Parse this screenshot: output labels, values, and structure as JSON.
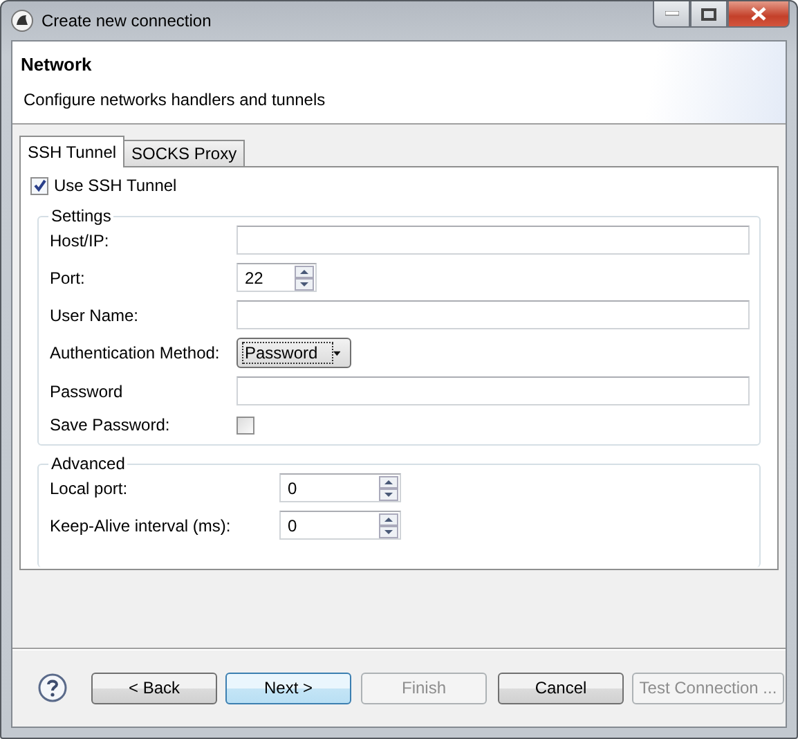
{
  "window": {
    "title": "Create new connection"
  },
  "header": {
    "title": "Network",
    "description": "Configure networks handlers and tunnels"
  },
  "tabs": [
    {
      "label": "SSH Tunnel",
      "selected": true
    },
    {
      "label": "SOCKS Proxy",
      "selected": false
    }
  ],
  "use_ssh_tunnel": {
    "label": "Use SSH Tunnel",
    "checked": true
  },
  "settings": {
    "title": "Settings",
    "fields": [
      {
        "kind": "text",
        "label": "Host/IP:"
      },
      {
        "kind": "spinner",
        "label": "Port:",
        "value": "22"
      },
      {
        "kind": "text",
        "label": "User Name:"
      },
      {
        "kind": "dropdown",
        "label": "Authentication Method:",
        "value": "Password"
      },
      {
        "kind": "text",
        "label": "Password"
      },
      {
        "kind": "checkbox",
        "label": "Save Password:",
        "checked": false
      }
    ]
  },
  "advanced": {
    "title": "Advanced",
    "fields": [
      {
        "kind": "spinner",
        "label": "Local port:",
        "value": "0"
      },
      {
        "kind": "spinner",
        "label": "Keep-Alive interval (ms):",
        "value": "0"
      }
    ]
  },
  "buttons": [
    {
      "label": "< Back",
      "disabled": false,
      "focused": false
    },
    {
      "label": "Next >",
      "disabled": false,
      "focused": true
    },
    {
      "label": "Finish",
      "disabled": true,
      "focused": false
    },
    {
      "label": "Cancel",
      "disabled": false,
      "focused": false
    },
    {
      "label": "Test Connection ...",
      "disabled": true,
      "focused": false
    }
  ]
}
